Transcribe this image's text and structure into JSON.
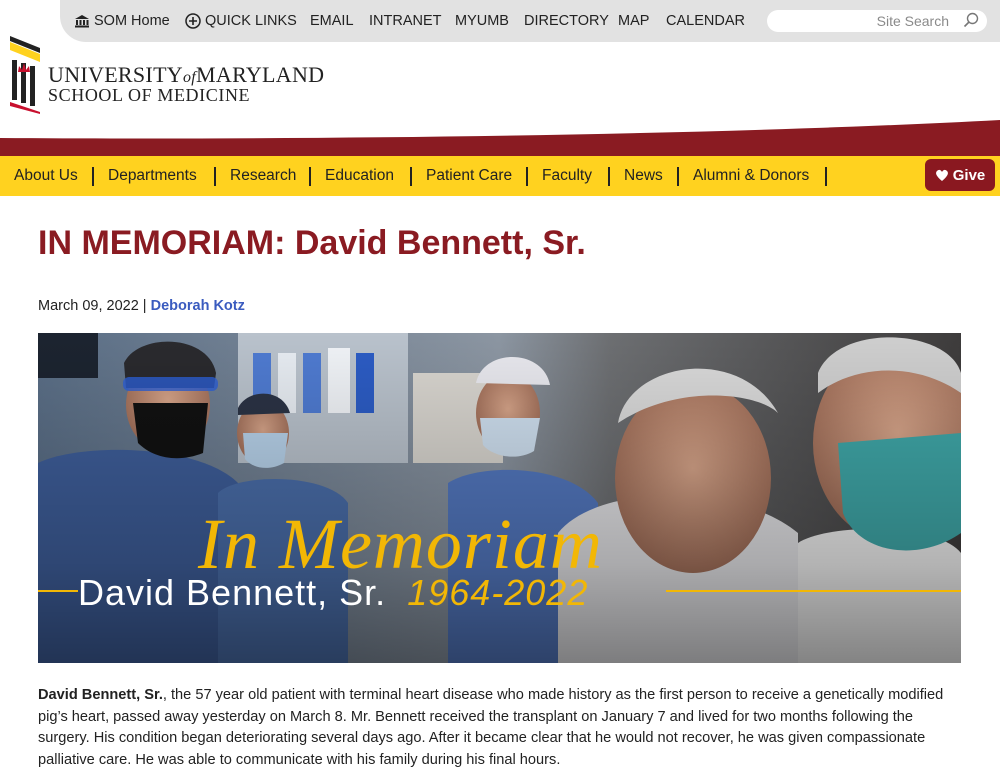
{
  "utility_nav": {
    "items": [
      {
        "label": "SOM Home",
        "icon": "building-icon"
      },
      {
        "label": "QUICK LINKS",
        "icon": "plus-circle-icon"
      },
      {
        "label": "EMAIL"
      },
      {
        "label": "INTRANET"
      },
      {
        "label": "MYUMB"
      },
      {
        "label": "DIRECTORY"
      },
      {
        "label": "MAP"
      },
      {
        "label": "CALENDAR"
      }
    ],
    "search_placeholder": "Site Search"
  },
  "logo": {
    "line1_a": "UNIVERSITY",
    "line1_of": "of",
    "line1_b": "MARYLAND",
    "line2": "SCHOOL OF MEDICINE"
  },
  "main_nav": {
    "items": [
      "About Us",
      "Departments",
      "Research",
      "Education",
      "Patient Care",
      "Faculty",
      "News",
      "Alumni & Donors"
    ],
    "give_label": "Give"
  },
  "article": {
    "title": "IN MEMORIAM: David Bennett, Sr.",
    "date": "March 09, 2022",
    "separator": "|",
    "author": "Deborah Kotz",
    "hero": {
      "script_title": "In Memoriam",
      "name": "David Bennett, Sr.",
      "years": "1964-2022"
    },
    "body_lead": "David Bennett, Sr.",
    "body_rest": ", the 57 year old patient with terminal heart disease who made history as the first person to receive a genetically modified pig’s heart, passed away yesterday on March 8. Mr. Bennett received the transplant on January 7 and lived for two months following the surgery. His condition began deteriorating several days ago. After it became clear that he would not recover, he was given compassionate palliative care. He was able to communicate with his family during his final hours."
  },
  "colors": {
    "maroon": "#8a1b22",
    "gold": "#ffd21f",
    "link_blue": "#3a5bbf",
    "utility_gray": "#e2e2e2"
  }
}
